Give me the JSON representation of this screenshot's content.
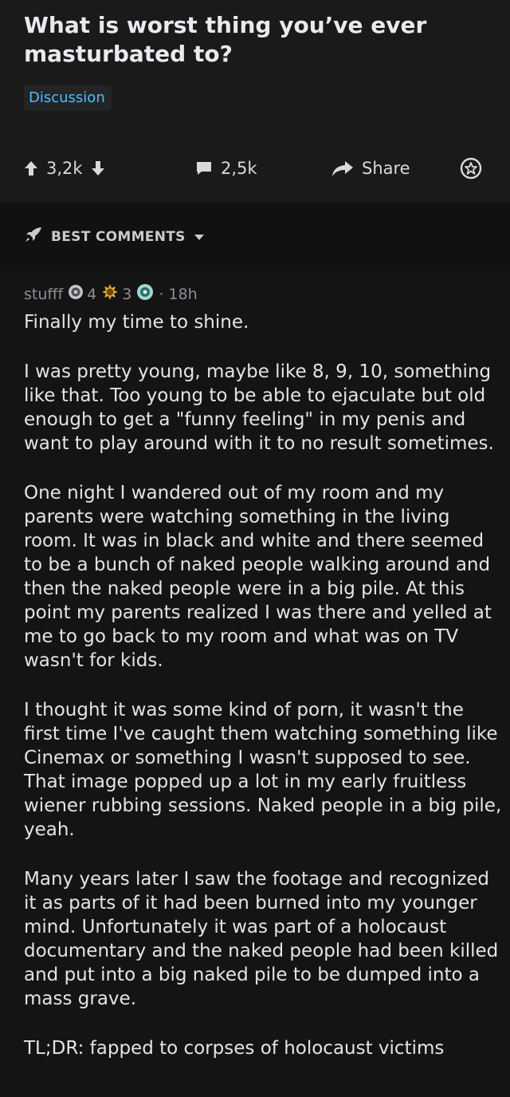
{
  "post": {
    "title": "What is worst thing you’ve ever masturbated to?",
    "flair": "Discussion",
    "upvotes": "3,2k",
    "comments": "2,5k",
    "share_label": "Share"
  },
  "sort": {
    "label": "BEST COMMENTS"
  },
  "comment": {
    "author": "stufff",
    "award1_count": "4",
    "award2_count": "3",
    "separator": "·",
    "age": "18h",
    "paragraphs": [
      "Finally my time to shine.",
      "I was pretty young, maybe like 8, 9, 10, something like that. Too young to be able to ejaculate but old enough to get a \"funny feeling\" in my penis and want to play around with it to no result sometimes.",
      "One night I wandered out of my room and my parents were watching something in the living room. It was in black and white and there seemed to be a bunch of naked people walking around and then the naked people were in a big pile. At this point my parents realized I was there and yelled at me to go back to my room and what was on TV wasn't for kids.",
      "I thought it was some kind of porn, it wasn't the first time I've caught them watching something like Cinemax or something I wasn't supposed to see. That image popped up a lot in my early fruitless wiener rubbing sessions. Naked people in a big pile, yeah.",
      "Many years later I saw the footage and recognized it as parts of it had been burned into my younger mind. Unfortunately it was part of a holocaust documentary and the naked people had been killed and put into a big naked pile to be dumped into a mass grave.",
      "TL;DR: fapped to corpses of holocaust victims"
    ]
  },
  "colors": {
    "background": "#1a1a1b",
    "flair_text": "#4fbcff",
    "meta_text": "#8c8f93",
    "text": "#e2e4e6"
  }
}
